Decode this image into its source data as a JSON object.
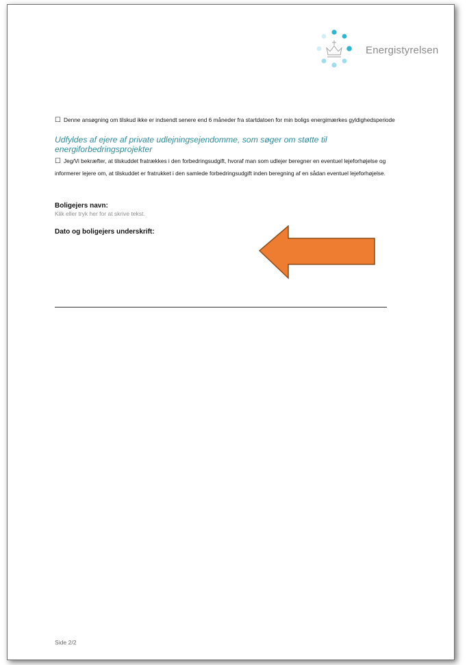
{
  "logo": {
    "text": "Energistyrelsen",
    "icon": "crown-dots-logo",
    "dot_colors": [
      "#2fb4d3",
      "#9fdcec",
      "#d4eef6"
    ]
  },
  "body": {
    "checkbox1_glyph": "☐",
    "para1": "Denne ansøgning om tilskud ikke er indsendt senere end 6 måneder fra startdatoen for min boligs energimærkes gyldighedsperiode",
    "heading": "Udfyldes af ejere af private udlejningsejendomme, som søger om støtte til energiforbedringsprojekter",
    "checkbox2_glyph": "☐",
    "para2": "Jeg/Vi bekræfter, at tilskuddet fratrækkes i den forbedringsudgift, hvoraf man som udlejer beregner en eventuel lejeforhøjelse og informerer lejere om, at tilskuddet er fratrukket i den samlede forbedringsudgift inden beregning af en sådan eventuel lejeforhøjelse.",
    "owner_name_label": "Boligejers navn:",
    "owner_name_placeholder": "Klik eller tryk her for at skrive tekst.",
    "signature_label": "Dato og boligejers underskrift:"
  },
  "footer": {
    "page": "Side 2/2"
  },
  "annotation": {
    "arrow_icon": "left-arrow-icon",
    "fill": "#ef7d31",
    "stroke": "#8a4b16"
  },
  "colors": {
    "heading": "#2b8c9a",
    "placeholder": "#8c8c8c"
  }
}
